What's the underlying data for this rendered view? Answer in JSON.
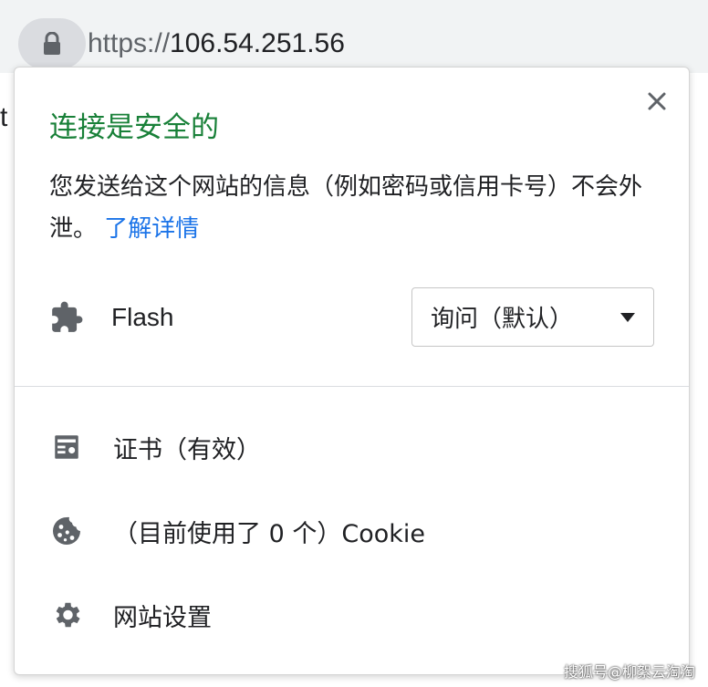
{
  "address_bar": {
    "scheme": "https://",
    "host": "106.54.251.56"
  },
  "page": {
    "visible_letter": "t"
  },
  "popup": {
    "title": "连接是安全的",
    "description": "您发送给这个网站的信息（例如密码或信用卡号）不会外泄。",
    "learn_more": "了解详情",
    "flash": {
      "label": "Flash",
      "select_value": "询问（默认）"
    },
    "items": [
      {
        "label": "证书（有效）",
        "icon": "certificate-icon"
      },
      {
        "label": "（目前使用了 0 个）Cookie",
        "icon": "cookie-icon"
      },
      {
        "label": "网站设置",
        "icon": "gear-icon"
      }
    ]
  },
  "watermark": "搜狐号@柳絮云淘淘",
  "colors": {
    "secure_green": "#188038",
    "link_blue": "#1a73e8",
    "icon_gray": "#5f6368"
  }
}
